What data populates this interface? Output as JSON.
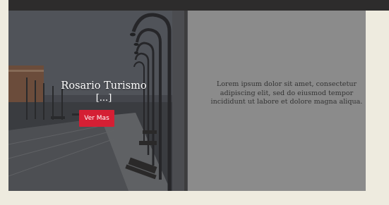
{
  "card": {
    "title": "Rosario Turismo",
    "ellipsis": "[...]",
    "button_label": "Ver Mas",
    "body_text": "Lorem ipsum dolor sit amet, consectetur adipiscing elit, sed do eiusmod tempor incididunt ut labore et dolore magna aliqua."
  },
  "colors": {
    "page_background": "#eeebdf",
    "top_bar": "#2d2c2c",
    "card_panel": "#8b8b8b",
    "button": "#d51f34",
    "text": "#333333"
  }
}
